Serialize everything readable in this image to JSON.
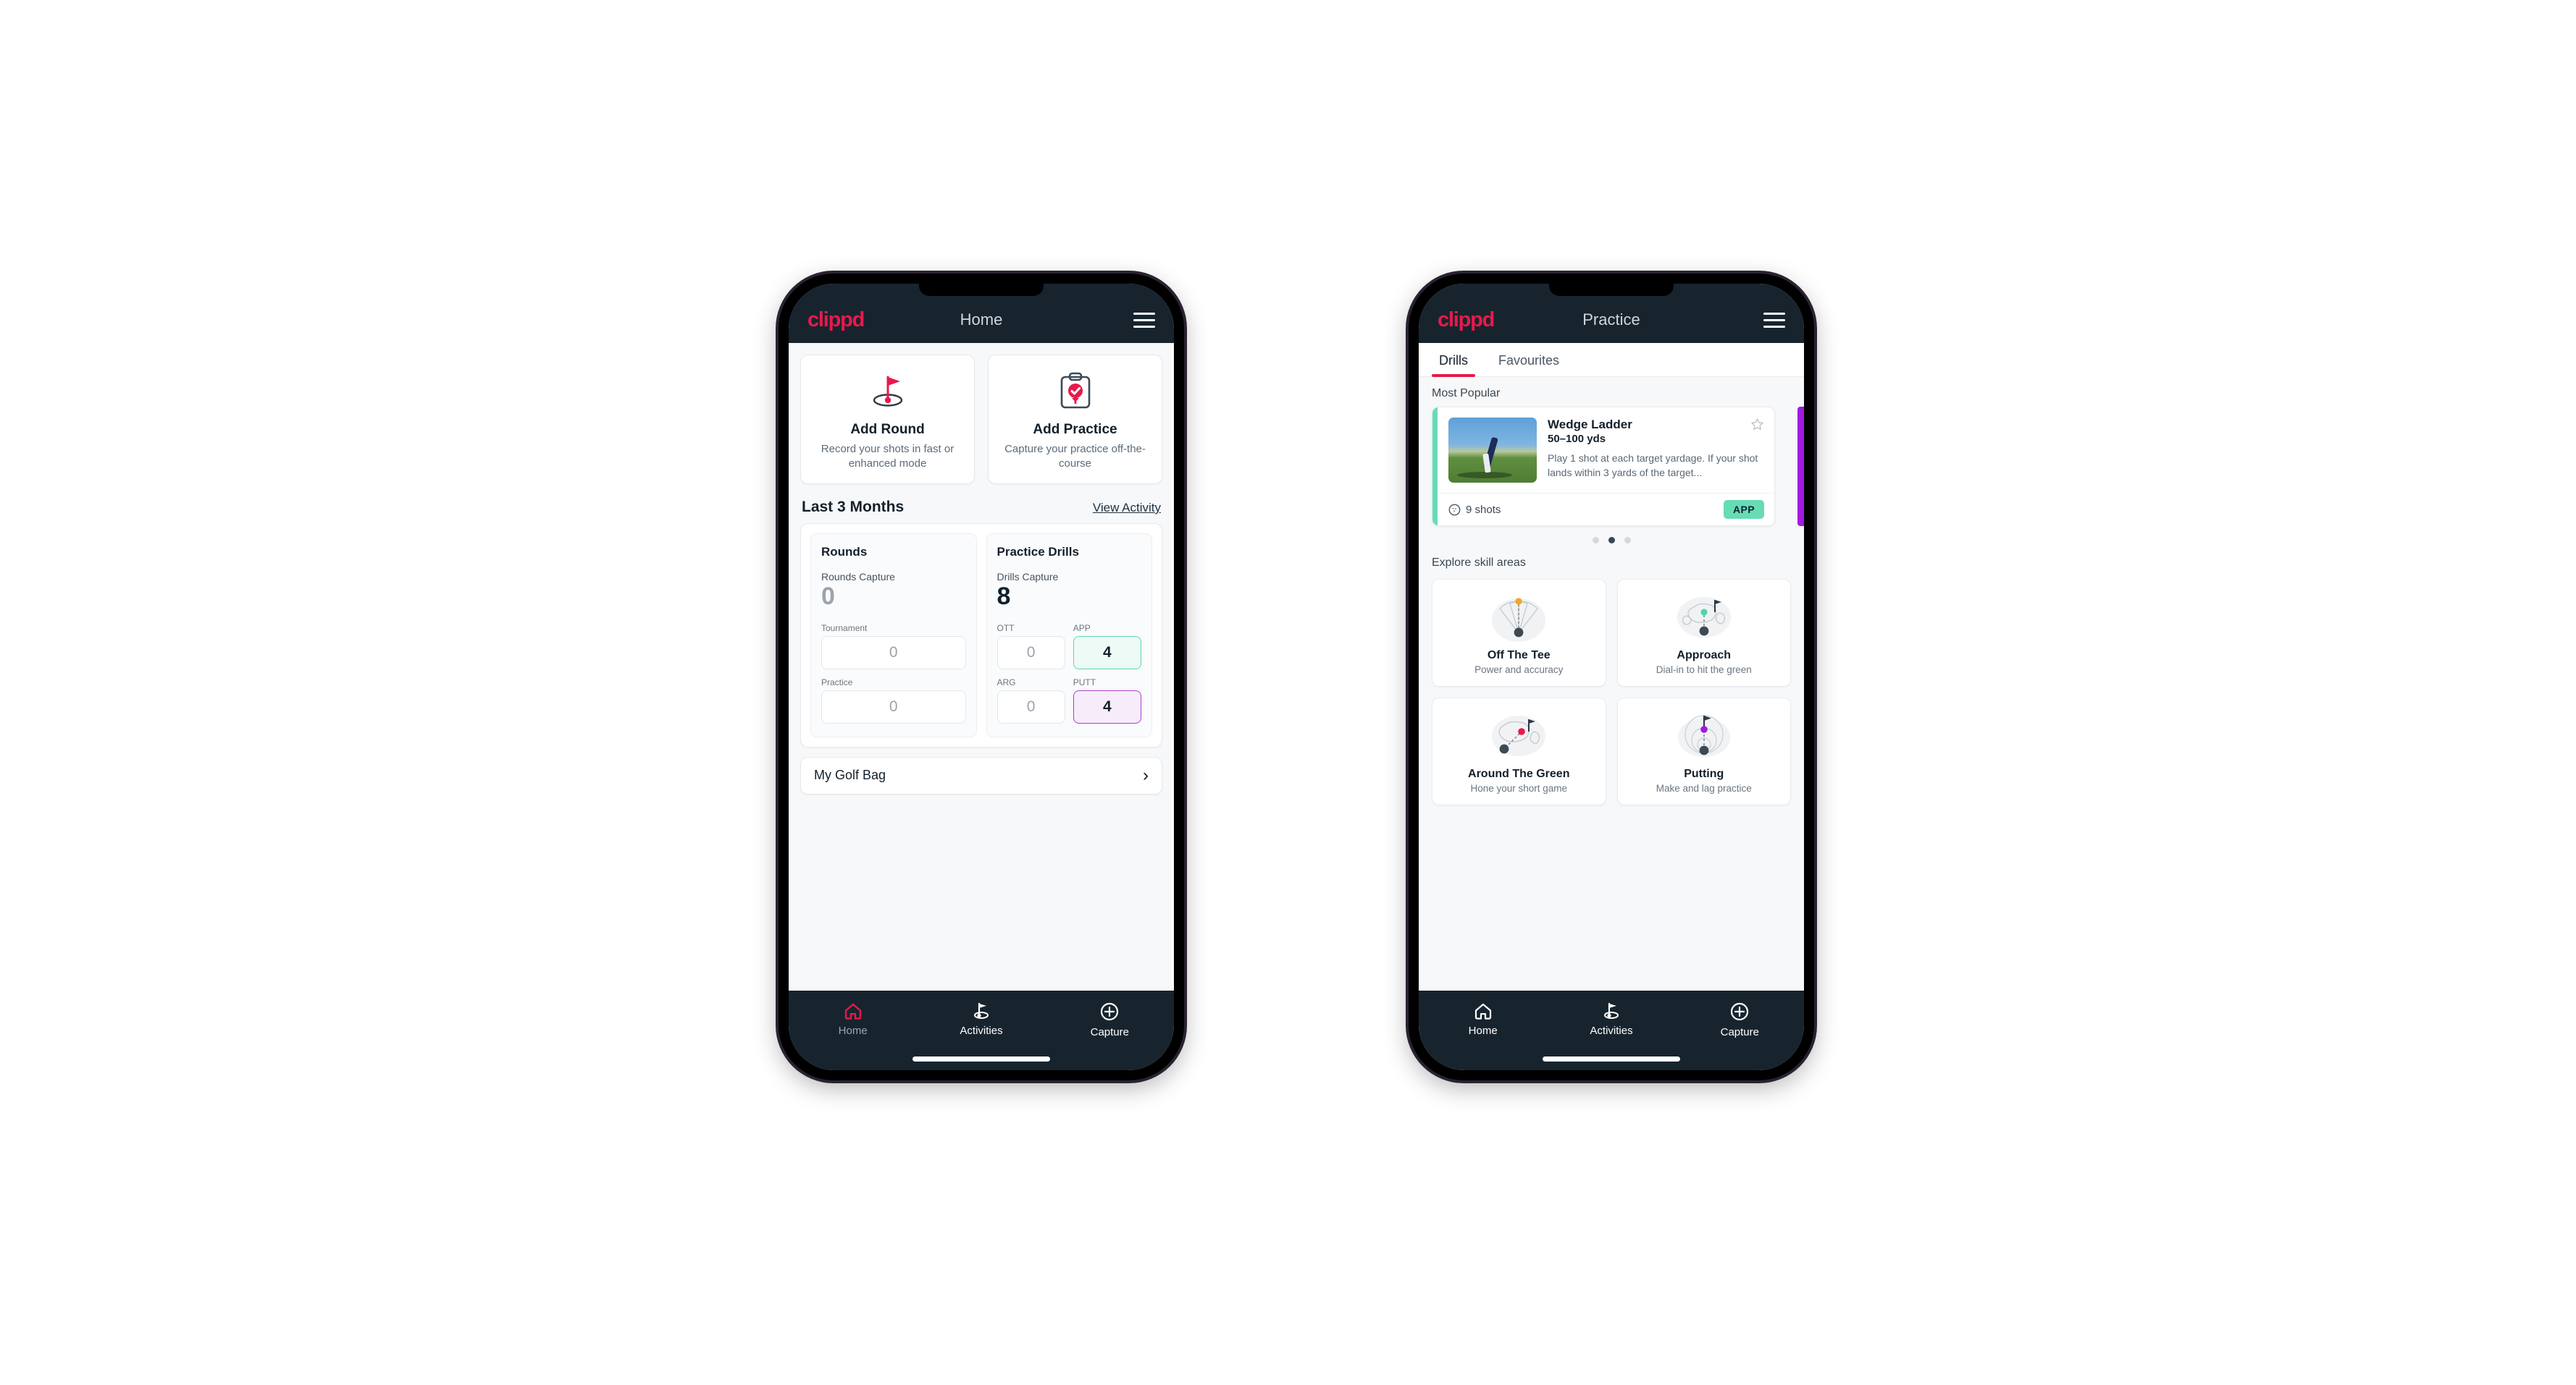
{
  "phone1": {
    "appbar": {
      "logo": "clippd",
      "title": "Home",
      "menu_icon": "hamburger-icon"
    },
    "quick_actions": [
      {
        "icon": "golf-flag-hole-icon",
        "title": "Add Round",
        "subtitle": "Record your shots in fast or enhanced mode"
      },
      {
        "icon": "clipboard-check-icon",
        "title": "Add Practice",
        "subtitle": "Capture your practice off-the-course"
      }
    ],
    "section": {
      "title": "Last 3 Months",
      "link": "View Activity"
    },
    "stats": {
      "rounds": {
        "heading": "Rounds",
        "capture_label": "Rounds Capture",
        "capture_value": "0",
        "fields": [
          {
            "label": "Tournament",
            "value": "0",
            "accent": "none"
          },
          {
            "label": "Practice",
            "value": "0",
            "accent": "none"
          }
        ]
      },
      "drills": {
        "heading": "Practice Drills",
        "capture_label": "Drills Capture",
        "capture_value": "8",
        "fields": [
          {
            "label": "OTT",
            "value": "0",
            "accent": "none"
          },
          {
            "label": "APP",
            "value": "4",
            "accent": "green"
          },
          {
            "label": "ARG",
            "value": "0",
            "accent": "none"
          },
          {
            "label": "PUTT",
            "value": "4",
            "accent": "purple"
          }
        ]
      }
    },
    "golf_bag": {
      "label": "My Golf Bag",
      "chevron": "chevron-right-icon"
    },
    "bottom_nav": [
      {
        "icon": "home-icon",
        "label": "Home",
        "active": true
      },
      {
        "icon": "golf-flag-icon",
        "label": "Activities",
        "active": false
      },
      {
        "icon": "plus-circle-icon",
        "label": "Capture",
        "active": false
      }
    ]
  },
  "phone2": {
    "appbar": {
      "logo": "clippd",
      "title": "Practice",
      "menu_icon": "hamburger-icon"
    },
    "tabs": [
      {
        "label": "Drills",
        "active": true
      },
      {
        "label": "Favourites",
        "active": false
      }
    ],
    "most_popular_label": "Most Popular",
    "drill": {
      "title": "Wedge Ladder",
      "yardage": "50–100 yds",
      "description": "Play 1 shot at each target yardage. If your shot lands within 3 yards of the target...",
      "shots": "9 shots",
      "badge": "APP",
      "favourite_icon": "star-outline-icon",
      "shots_icon": "golf-ball-icon",
      "accent_color": "#66dcb4",
      "peek_accent_color": "#a11ae0"
    },
    "carousel_dots": {
      "count": 3,
      "active_index": 1
    },
    "skill_label": "Explore skill areas",
    "skills": [
      {
        "icon": "tee-shot-fan-icon",
        "title": "Off The Tee",
        "subtitle": "Power and accuracy",
        "marker_color": "#f5a623"
      },
      {
        "icon": "green-approach-icon",
        "title": "Approach",
        "subtitle": "Dial-in to hit the green",
        "marker_color": "#4fd6aa"
      },
      {
        "icon": "chip-around-green-icon",
        "title": "Around The Green",
        "subtitle": "Hone your short game",
        "marker_color": "#e8194b"
      },
      {
        "icon": "putting-rings-icon",
        "title": "Putting",
        "subtitle": "Make and lag practice",
        "marker_color": "#a11ae0"
      }
    ],
    "bottom_nav": [
      {
        "icon": "home-icon",
        "label": "Home",
        "active": false
      },
      {
        "icon": "golf-flag-icon",
        "label": "Activities",
        "active": false
      },
      {
        "icon": "plus-circle-icon",
        "label": "Capture",
        "active": false
      }
    ]
  },
  "theme": {
    "brand_pink": "#e8194b",
    "appbar_dark": "#17242e",
    "page_bg": "#f7f8fa",
    "accent_green": "#66dcb4",
    "accent_purple": "#a11ae0"
  }
}
